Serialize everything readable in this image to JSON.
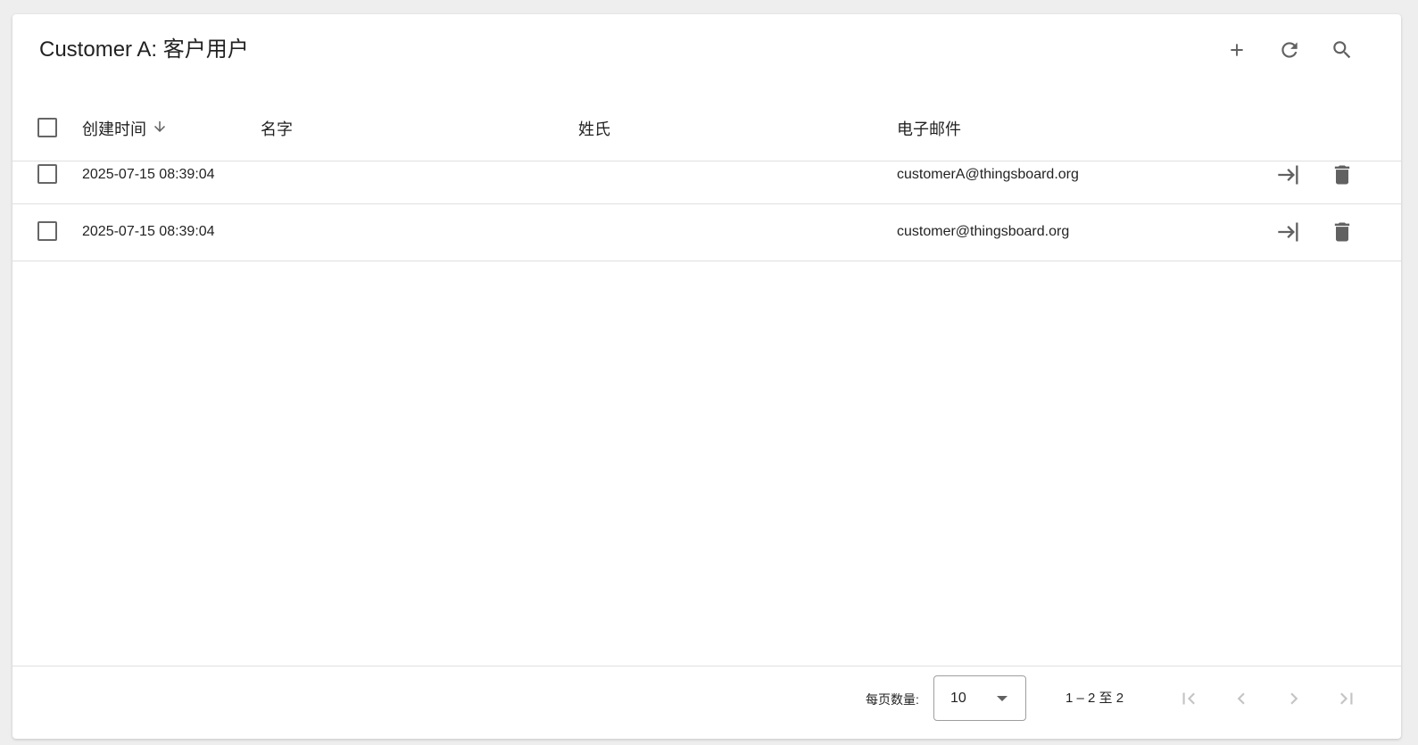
{
  "header": {
    "title": "Customer A: 客户用户"
  },
  "toolbar": {
    "add_icon": "add-icon",
    "refresh_icon": "refresh-icon",
    "search_icon": "search-icon"
  },
  "table": {
    "columns": [
      {
        "label": "创建时间",
        "sorted": "desc"
      },
      {
        "label": "名字"
      },
      {
        "label": "姓氏"
      },
      {
        "label": "电子邮件"
      }
    ],
    "rows": [
      {
        "created": "2025-07-15 08:39:04",
        "first_name": "",
        "last_name": "",
        "email": "customerA@thingsboard.org"
      },
      {
        "created": "2025-07-15 08:39:04",
        "first_name": "",
        "last_name": "",
        "email": "customer@thingsboard.org"
      }
    ],
    "row_actions": [
      "login-icon",
      "delete-icon"
    ]
  },
  "paginator": {
    "page_size_label": "每页数量:",
    "page_size": "10",
    "range_label": "1 – 2 至 2"
  },
  "colors": {
    "background": "#eeeeee",
    "card": "#ffffff",
    "icon": "#616161",
    "divider": "#e0e0e0",
    "disabled_icon": "#c4c4c4"
  }
}
